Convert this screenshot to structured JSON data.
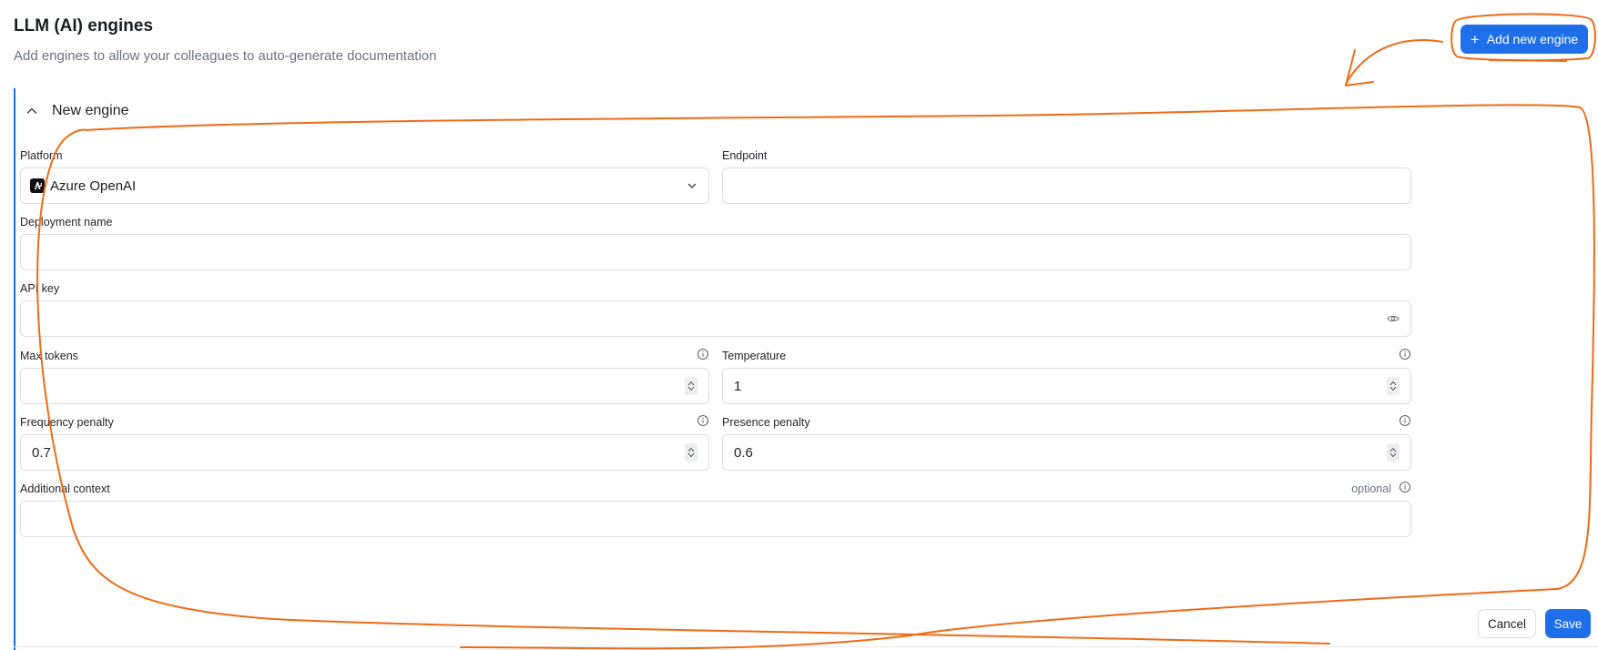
{
  "page": {
    "title": "LLM (AI) engines",
    "subtitle": "Add engines to allow your colleagues to auto-generate documentation"
  },
  "toolbar": {
    "add_label": "Add new engine",
    "add_icon": "plus-icon"
  },
  "panel": {
    "title": "New engine",
    "expanded": true,
    "fields": {
      "platform": {
        "label": "Platform",
        "value": "Azure OpenAI",
        "icon": "azure-openai-logo"
      },
      "endpoint": {
        "label": "Endpoint",
        "value": ""
      },
      "deployment": {
        "label": "Deployment name",
        "value": ""
      },
      "api_key": {
        "label": "API key",
        "value": ""
      },
      "max_tokens": {
        "label": "Max tokens",
        "value": ""
      },
      "temperature": {
        "label": "Temperature",
        "value": "1"
      },
      "frequency_penalty": {
        "label": "Frequency penalty",
        "value": "0.7"
      },
      "presence_penalty": {
        "label": "Presence penalty",
        "value": "0.6"
      },
      "additional_context": {
        "label": "Additional context",
        "value": "",
        "optional_label": "optional"
      }
    }
  },
  "actions": {
    "cancel_label": "Cancel",
    "save_label": "Save"
  },
  "colors": {
    "accent": "#1f6feb",
    "annotation": "#f06a14"
  }
}
